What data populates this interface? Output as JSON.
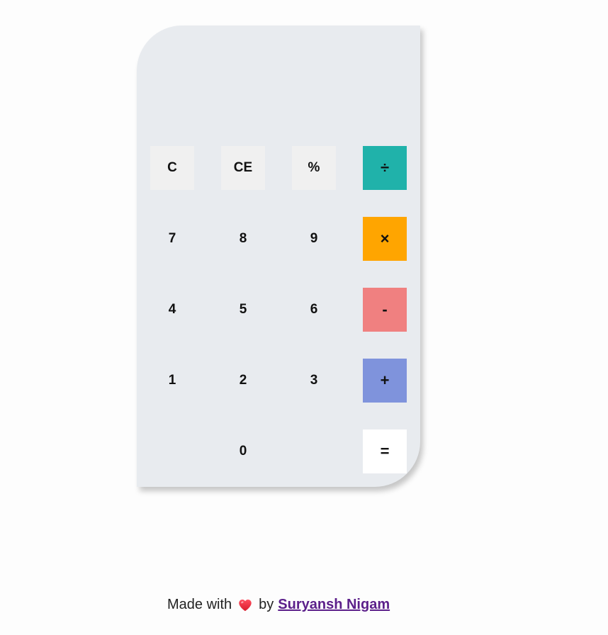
{
  "calculator": {
    "display_value": "",
    "keys": {
      "clear": "C",
      "clear_entry": "CE",
      "percent": "%",
      "divide": "÷",
      "seven": "7",
      "eight": "8",
      "nine": "9",
      "multiply": "×",
      "four": "4",
      "five": "5",
      "six": "6",
      "subtract": "-",
      "one": "1",
      "two": "2",
      "three": "3",
      "add": "+",
      "zero": "0",
      "equals": "="
    },
    "colors": {
      "body": "#e8ebef",
      "function_key": "#f0f0f0",
      "divide": "#20b2aa",
      "multiply": "#ffa500",
      "subtract": "#f08080",
      "add": "#7f93dc",
      "equals": "#ffffff"
    }
  },
  "footer": {
    "made_with": "Made with",
    "heart_icon": "heart-icon",
    "by": "by",
    "author_link": "Suryansh Nigam"
  }
}
